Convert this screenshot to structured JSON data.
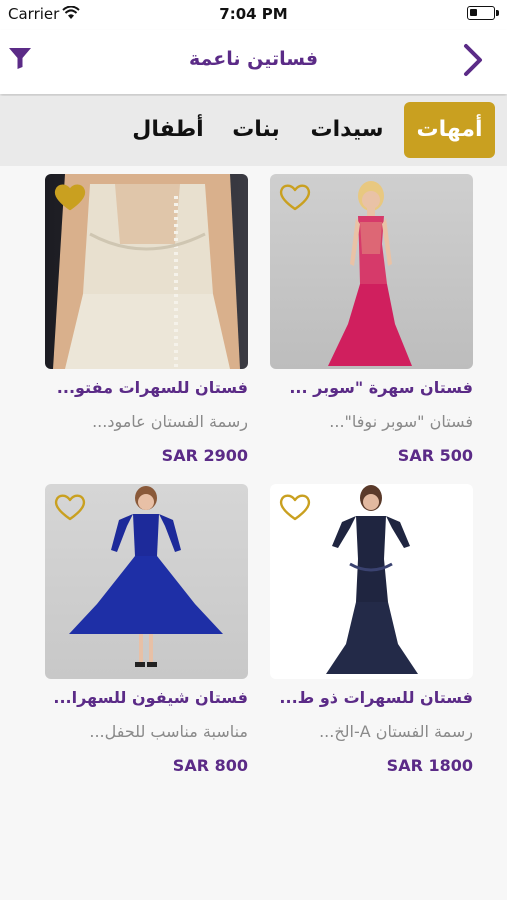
{
  "status_bar": {
    "carrier": "Carrier",
    "time": "7:04 PM"
  },
  "nav": {
    "title": "فساتين ناعمة",
    "left_icon": "filter-icon",
    "right_icon": "chevron-right-icon"
  },
  "tabs": [
    {
      "label": "أمهات",
      "active": true
    },
    {
      "label": "سيدات",
      "active": false
    },
    {
      "label": "بنات",
      "active": false
    },
    {
      "label": "أطفال",
      "active": false
    }
  ],
  "colors": {
    "accent": "#c9a020",
    "brand": "#5b2b87",
    "muted": "#8a8a8a"
  },
  "products": [
    {
      "title": "فستان سهرة \"سوبر ...",
      "description": "فستان \"سوبر نوفا\"...",
      "price": "SAR 500",
      "favorite": false,
      "heart_color": "#c9a020"
    },
    {
      "title": "فستان للسهرات مفتو...",
      "description": "رسمة الفستان عامود...",
      "price": "SAR 2900",
      "favorite": true,
      "heart_color": "#c9a020"
    },
    {
      "title": "فستان للسهرات ذو ط...",
      "description": "رسمة الفستان A-الخ...",
      "price": "SAR 1800",
      "favorite": false,
      "heart_color": "#c9a020"
    },
    {
      "title": "فستان شيفون للسهرا...",
      "description": "مناسبة مناسب للحفل...",
      "price": "SAR 800",
      "favorite": false,
      "heart_color": "#c9a020"
    }
  ]
}
